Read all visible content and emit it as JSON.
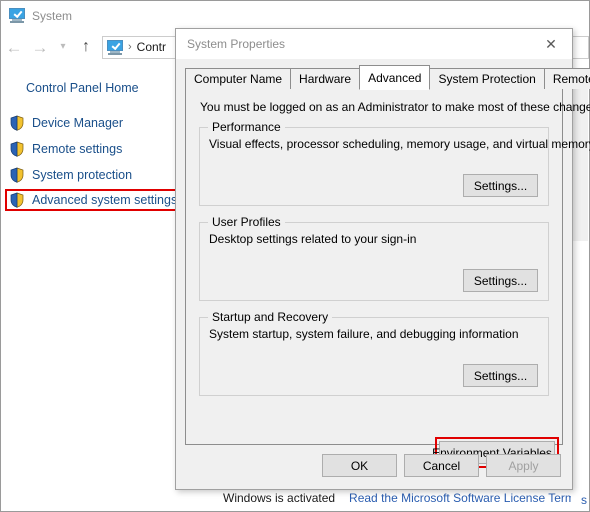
{
  "system_window": {
    "title": "System",
    "title_icon": "monitor-icon",
    "nav": {
      "back_icon": "arrow-left-icon",
      "forward_icon": "arrow-right-icon",
      "recent_icon": "chevron-down-icon",
      "up_icon": "arrow-up-icon",
      "address_icon": "monitor-icon",
      "separator": "›",
      "breadcrumb_text": "Contr"
    },
    "sidebar": {
      "home_label": "Control Panel Home",
      "items": [
        {
          "label": "Device Manager",
          "icon": "shield-icon",
          "highlighted": false
        },
        {
          "label": "Remote settings",
          "icon": "shield-icon",
          "highlighted": false
        },
        {
          "label": "System protection",
          "icon": "shield-icon",
          "highlighted": false
        },
        {
          "label": "Advanced system settings",
          "icon": "shield-icon",
          "highlighted": true
        }
      ]
    },
    "activation": {
      "status_text": "Windows is activated",
      "link_text": "Read the Microsoft Software License Terms",
      "edge_text": "s"
    }
  },
  "dialog": {
    "title": "System Properties",
    "close_icon": "close-icon",
    "tabs": [
      {
        "label": "Computer Name",
        "active": false
      },
      {
        "label": "Hardware",
        "active": false
      },
      {
        "label": "Advanced",
        "active": true
      },
      {
        "label": "System Protection",
        "active": false
      },
      {
        "label": "Remote",
        "active": false
      }
    ],
    "admin_note": "You must be logged on as an Administrator to make most of these changes.",
    "groups": [
      {
        "legend": "Performance",
        "description": "Visual effects, processor scheduling, memory usage, and virtual memory",
        "button_label": "Settings..."
      },
      {
        "legend": "User Profiles",
        "description": "Desktop settings related to your sign-in",
        "button_label": "Settings..."
      },
      {
        "legend": "Startup and Recovery",
        "description": "System startup, system failure, and debugging information",
        "button_label": "Settings..."
      }
    ],
    "environment_variables_label": "Environment Variables...",
    "footer": {
      "ok_label": "OK",
      "cancel_label": "Cancel",
      "apply_label": "Apply",
      "apply_disabled": true
    }
  },
  "colors": {
    "highlight_red": "#e00000",
    "link_blue": "#1a4f8a",
    "dialog_face": "#f0f0f0",
    "shield_blue": "#2b63b5",
    "shield_gold": "#f2c230"
  }
}
